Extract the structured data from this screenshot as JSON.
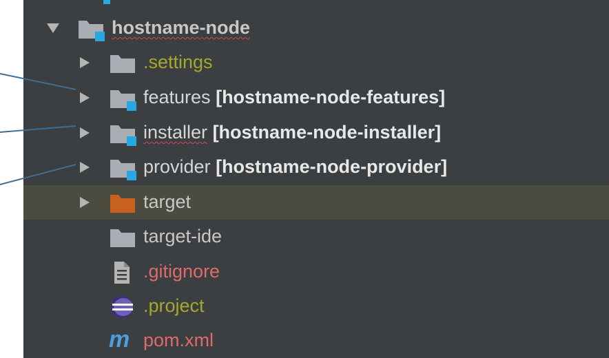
{
  "tree": {
    "root": {
      "label": "hostname-node"
    },
    "items": [
      {
        "name": ".settings",
        "module": ""
      },
      {
        "name": "features",
        "module": "[hostname-node-features]"
      },
      {
        "name": "installer",
        "module": "[hostname-node-installer]"
      },
      {
        "name": "provider",
        "module": "[hostname-node-provider]"
      },
      {
        "name": "target",
        "module": ""
      },
      {
        "name": "target-ide",
        "module": ""
      },
      {
        "name": ".gitignore",
        "module": ""
      },
      {
        "name": ".project",
        "module": ""
      },
      {
        "name": "pom.xml",
        "module": ""
      }
    ]
  },
  "colors": {
    "panel_background": "#3c3f41",
    "selected_row": "#4b4b3f",
    "excluded_text": "#a6a82b",
    "unversioned_text": "#e06a6a",
    "module_marker": "#29a8e0",
    "target_folder": "#c8611e",
    "callout_line": "#3f6e95"
  },
  "icons": {
    "root": "module-folder-icon",
    "folder": "folder-icon",
    "module": "module-folder-icon",
    "excluded": "excluded-folder-icon",
    "text_file": "text-file-icon",
    "eclipse": "eclipse-project-icon",
    "maven": "maven-icon"
  }
}
